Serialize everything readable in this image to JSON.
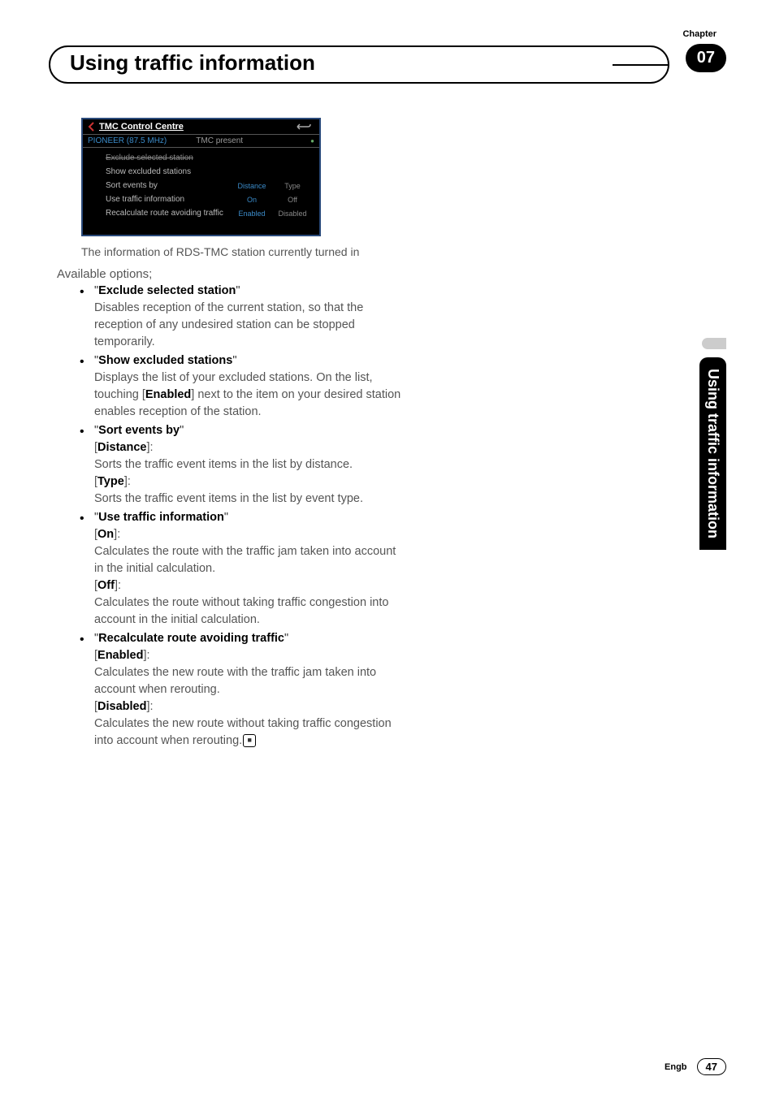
{
  "chapter": {
    "label": "Chapter",
    "num": "07"
  },
  "page_title": "Using traffic information",
  "side_tab": "Using traffic information",
  "screenshot": {
    "title": "TMC Control Centre",
    "station": "PIONEER (87.5 MHz)",
    "present": "TMC present",
    "rows": {
      "excl": "Exclude selected station",
      "show": "Show excluded stations",
      "sort": {
        "label": "Sort events by",
        "a": "Distance",
        "b": "Type"
      },
      "use": {
        "label": "Use traffic information",
        "a": "On",
        "b": "Off"
      },
      "recalc": {
        "label": "Recalculate route avoiding traffic",
        "a": "Enabled",
        "b": "Disabled"
      }
    }
  },
  "caption": "The information of RDS-TMC station currently turned in",
  "available": "Available options;",
  "options": {
    "exclude": {
      "title": "Exclude selected station",
      "desc": "Disables reception of the current station, so that the reception of any undesired station can be stopped temporarily."
    },
    "show": {
      "title": "Show excluded stations",
      "desc1": "Displays the list of your excluded stations. On the list, touching [",
      "key": "Enabled",
      "desc2": "] next to the item on your desired station enables reception of the station."
    },
    "sort": {
      "title": "Sort events by",
      "k1": "Distance",
      "d1": "Sorts the traffic event items in the list by distance.",
      "k2": "Type",
      "d2": "Sorts the traffic event items in the list by event type."
    },
    "use": {
      "title": "Use traffic information",
      "k1": "On",
      "d1": "Calculates the route with the traffic jam taken into account in the initial calculation.",
      "k2": "Off",
      "d2": "Calculates the route without taking traffic congestion into account in the initial calculation."
    },
    "recalc": {
      "title": "Recalculate route avoiding traffic",
      "k1": "Enabled",
      "d1": "Calculates the new route with the traffic jam taken into account when rerouting.",
      "k2": "Disabled",
      "d2": "Calculates the new route without taking traffic congestion into account when rerouting."
    }
  },
  "footer": {
    "lang": "Engb",
    "page": "47"
  }
}
